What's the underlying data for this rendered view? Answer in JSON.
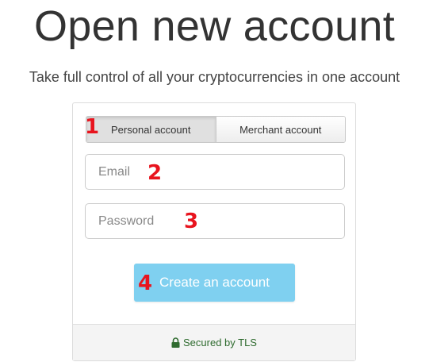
{
  "header": {
    "title": "Open new account",
    "subtitle": "Take full control of all your cryptocurrencies in one account"
  },
  "form": {
    "tabs": [
      {
        "label": "Personal account",
        "active": true
      },
      {
        "label": "Merchant account",
        "active": false
      }
    ],
    "email": {
      "placeholder": "Email",
      "value": ""
    },
    "password": {
      "placeholder": "Password",
      "value": ""
    },
    "submit_label": "Create an account",
    "footer": {
      "label": "Secured by TLS",
      "icon": "lock-icon"
    }
  },
  "annotations": [
    "1",
    "2",
    "3",
    "4"
  ],
  "colors": {
    "accent_button": "#7fd0f0",
    "footer_text": "#2f6b2f",
    "annotation_marker": "#e8141e"
  }
}
